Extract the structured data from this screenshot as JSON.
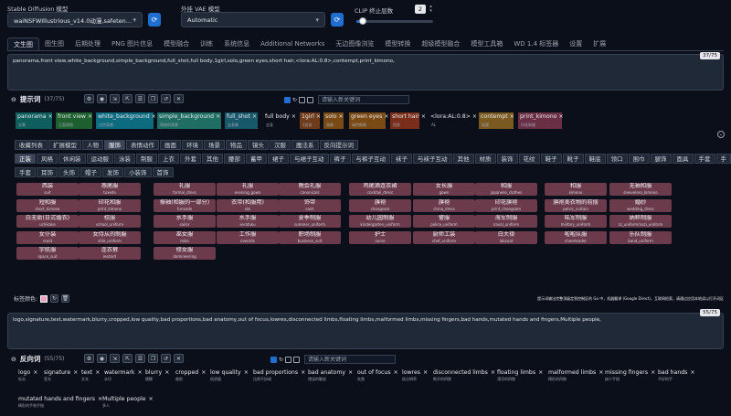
{
  "header": {
    "model_label": "Stable Diffusion 模型",
    "model_value": "waiNSFWIllustrious_v14.0动漫,safetensors [bd",
    "vae_label": "外挂 VAE 模型",
    "vae_value": "Automatic",
    "clip_label": "CLIP 终止层数",
    "clip_value": "2",
    "clip_fraction": 0.08
  },
  "main_tabs": [
    "文生图",
    "图生图",
    "后期处理",
    "PNG 图片信息",
    "模型融合",
    "训练",
    "系统信息",
    "Additional Networks",
    "无边图像浏览",
    "模型转换",
    "超级模型融合",
    "模型工具箱",
    "WD 1.4 标签器",
    "设置",
    "扩展"
  ],
  "positive": {
    "text": "panorama,front view,white_background,simple_background,full_shot,full body,1girl,solo,green eyes,short hair,<lora:AL:0.8>,contempt,print_kimono,",
    "counter": "37/75",
    "section_label": "提示词",
    "section_count": "(37/75)",
    "new_keyword_placeholder": "请输入新关键词",
    "chips": [
      {
        "en": "panorama",
        "zh": "全景",
        "bg": "#0f5e5e"
      },
      {
        "en": "front view",
        "zh": "正面视图",
        "bg": "#1d5f2e"
      },
      {
        "en": "white_background",
        "zh": "白色背景",
        "bg": "#0d6b80"
      },
      {
        "en": "simple_background",
        "zh": "简单的背景",
        "bg": "#1f6e63"
      },
      {
        "en": "full_shot",
        "zh": "全身像",
        "bg": "#17586a"
      },
      {
        "en": "full body",
        "zh": "全身",
        "bg": ""
      },
      {
        "en": "1girl",
        "zh": "1女孩",
        "bg": "#6e3c1b"
      },
      {
        "en": "solo",
        "zh": "独奏",
        "bg": "#7a4a14"
      },
      {
        "en": "green eyes",
        "zh": "绿色眼睛",
        "bg": "#7a4a14"
      },
      {
        "en": "short hair",
        "zh": "短发",
        "bg": "#7a2e1a"
      },
      {
        "en": "<lora:AL:0.8>",
        "zh": "AL",
        "bg": ""
      },
      {
        "en": "contempt",
        "zh": "轻蔑",
        "bg": "#7a5a20"
      },
      {
        "en": "print_kimono",
        "zh": "印花和服",
        "bg": "#6b2f45"
      }
    ]
  },
  "category_tabs_row1": [
    "收藏列表",
    "扩展模型",
    "人物",
    "服饰",
    "表情动作",
    "画面",
    "环境",
    "场景",
    "物品",
    "镜头",
    "汉服",
    "魔法系",
    "反向提示词"
  ],
  "category_active": "服饰",
  "category_tabs_row2": [
    "正装",
    "风格",
    "休闲装",
    "运动服",
    "泳装",
    "制服",
    "上衣",
    "外套",
    "其他",
    "腰部",
    "蓄甲",
    "裙子",
    "与裙子互动",
    "裤子",
    "与裤子互动",
    "袜子",
    "与袜子互动",
    "其他",
    "材质",
    "装饰",
    "花纹",
    "鞋子",
    "靴子",
    "鞋底",
    "领口",
    "围巾",
    "腿饰",
    "面具",
    "手套",
    "手"
  ],
  "category_tabs_row3": [
    "手套",
    "耳饰",
    "头饰",
    "帽子",
    "发饰",
    "小装饰",
    "首饰"
  ],
  "tag_grid": [
    [
      {
        "zh": "西装",
        "en": "suit"
      },
      {
        "zh": "燕尾服",
        "en": "tuxedo"
      },
      {
        "zh": "礼服",
        "en": "formal_dress"
      },
      {
        "zh": "礼服",
        "en": "evening_gown"
      },
      {
        "zh": "晚会礼服",
        "en": "canonicals"
      },
      {
        "zh": "鸡尾酒连衣裙",
        "en": "cocktail_dress"
      },
      {
        "zh": "女长服",
        "en": "gown"
      },
      {
        "zh": "和服",
        "en": "japanese_clothes"
      },
      {
        "zh": "和服",
        "en": "kimono"
      },
      {
        "zh": "无袖和服",
        "en": "sleeveless_kimono"
      }
    ],
    [
      {
        "zh": "短和服",
        "en": "short_kimono"
      },
      {
        "zh": "印花和服",
        "en": "print_kimono"
      },
      {
        "zh": "振袖(和服的一部分)",
        "en": "furisode"
      },
      {
        "zh": "衣带(和服用)",
        "en": "obi"
      },
      {
        "zh": "饰带",
        "en": "sash"
      },
      {
        "zh": "旗袍",
        "en": "chongsam"
      },
      {
        "zh": "旗袍",
        "en": "china_dress"
      },
      {
        "zh": "印花旗袍",
        "en": "print_chongsam"
      },
      {
        "zh": "旗袍美衣物的前摆",
        "en": "pelvic_curtain"
      },
      {
        "zh": "婚纱",
        "en": "wedding_dress"
      }
    ],
    [
      {
        "zh": "白无垢(日式婚衣)",
        "en": "uchikake"
      },
      {
        "zh": "校服",
        "en": "school_uniform"
      },
      {
        "zh": "水手服",
        "en": "sailor"
      },
      {
        "zh": "水手服",
        "en": "serafuku"
      },
      {
        "zh": "夏季制服",
        "en": "summer_uniform"
      },
      {
        "zh": "幼儿园制服",
        "en": "kindergarten_uniform"
      },
      {
        "zh": "警服",
        "en": "police_uniform"
      },
      {
        "zh": "海军制服",
        "en": "naval_uniform"
      },
      {
        "zh": "陆军制服",
        "en": "military_uniform"
      },
      {
        "zh": "纳粹制服",
        "en": "ss_uniform/nazi_uniform"
      }
    ],
    [
      {
        "zh": "女仆装",
        "en": "maid"
      },
      {
        "zh": "女侍从的制服",
        "en": "stile_uniform"
      },
      {
        "zh": "巫女服",
        "en": "miko"
      },
      {
        "zh": "工作服",
        "en": "overalls"
      },
      {
        "zh": "职场制服",
        "en": "business_suit"
      },
      {
        "zh": "护士",
        "en": "nurse"
      },
      {
        "zh": "厨师工装",
        "en": "chef_uniform"
      },
      {
        "zh": "白大褂",
        "en": "labcoat"
      },
      {
        "zh": "啦啦队服",
        "en": "cheerleader"
      },
      {
        "zh": "乐队制服",
        "en": "band_uniform"
      }
    ],
    [
      {
        "zh": "宇航服",
        "en": "space_suit"
      },
      {
        "zh": "连衣裤",
        "en": "leotard"
      },
      {
        "zh": "修女服",
        "en": "domineering"
      }
    ]
  ],
  "tag_color_label": "标签颜色:",
  "hint_text": "提示词输出完整顶级定到控制区的 Go 中，机器翻译 (Google Direct)，互联网检索，请通过应用本地读以打开词区",
  "negative": {
    "text": "logo,signature,text,watermark,blurry,cropped,low quality,bad proportions,bad anatomy,out of focus,lowres,disconnected limbs,floating limbs,malformed limbs,missing fingers,bad hands,mutated hands and fingers,Multiple people,",
    "counter": "55/75",
    "section_label": "反向词",
    "section_count": "(55/75)",
    "new_keyword_placeholder": "请输入新关键词",
    "chips_row1": [
      {
        "en": "logo",
        "zh": "标志"
      },
      {
        "en": "signature",
        "zh": "签名"
      },
      {
        "en": "text",
        "zh": "文本"
      },
      {
        "en": "watermark",
        "zh": "水印"
      },
      {
        "en": "blurry",
        "zh": "模糊"
      },
      {
        "en": "cropped",
        "zh": "裁剪"
      },
      {
        "en": "low quality",
        "zh": "低质量"
      },
      {
        "en": "bad proportions",
        "zh": "比例不协调"
      },
      {
        "en": "bad anatomy",
        "zh": "错误的解剖"
      },
      {
        "en": "out of focus",
        "zh": "失焦"
      },
      {
        "en": "lowres",
        "zh": "低分辨率"
      },
      {
        "en": "disconnected limbs",
        "zh": "断开的四肢"
      },
      {
        "en": "floating limbs",
        "zh": "漂浮的四肢"
      },
      {
        "en": "malformed limbs",
        "zh": "畸形的四肢"
      },
      {
        "en": "missing fingers",
        "zh": "缺少手指"
      },
      {
        "en": "bad hands",
        "zh": "不好的手"
      }
    ],
    "chips_row2": [
      {
        "en": "mutated hands and fingers",
        "zh": "畸形的手和手指"
      },
      {
        "en": "Multiple people",
        "zh": "多人"
      }
    ]
  },
  "colors": {
    "accent": "#1f6fd1",
    "tag": "#6b3a4b",
    "bg": "#0b0f19"
  }
}
